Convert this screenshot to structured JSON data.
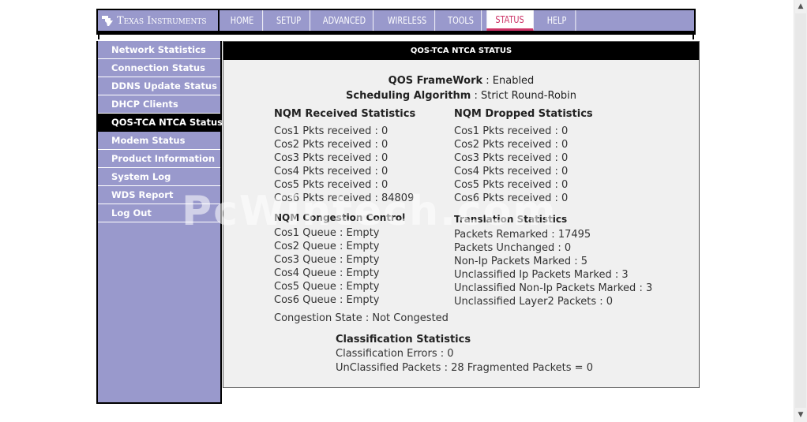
{
  "brand": {
    "name": "Texas Instruments",
    "icon": "ti-logo-icon"
  },
  "nav": {
    "tabs": [
      {
        "label": "HOME",
        "active": false
      },
      {
        "label": "SETUP",
        "active": false
      },
      {
        "label": "ADVANCED",
        "active": false
      },
      {
        "label": "WIRELESS",
        "active": false
      },
      {
        "label": "TOOLS",
        "active": false
      },
      {
        "label": "STATUS",
        "active": true
      },
      {
        "label": "HELP",
        "active": false
      }
    ]
  },
  "sidebar": {
    "items": [
      {
        "label": "Network Statistics",
        "active": false
      },
      {
        "label": "Connection Status",
        "active": false
      },
      {
        "label": "DDNS Update Status",
        "active": false
      },
      {
        "label": "DHCP Clients",
        "active": false
      },
      {
        "label": "QOS-TCA NTCA Status",
        "active": true
      },
      {
        "label": "Modem Status",
        "active": false
      },
      {
        "label": "Product Information",
        "active": false
      },
      {
        "label": "System Log",
        "active": false
      },
      {
        "label": "WDS Report",
        "active": false
      },
      {
        "label": "Log Out",
        "active": false
      }
    ]
  },
  "panel": {
    "title": "QOS-TCA NTCA STATUS",
    "framework": {
      "label": "QOS FrameWork",
      "value": " : Enabled"
    },
    "scheduling": {
      "label": "Scheduling Algorithm",
      "value": " : Strict Round-Robin"
    },
    "received": {
      "heading": "NQM Received Statistics",
      "rows": [
        "Cos1 Pkts received : 0",
        "Cos2 Pkts received : 0",
        "Cos3 Pkts received : 0",
        "Cos4 Pkts received : 0",
        "Cos5 Pkts received : 0",
        "Cos6 Pkts received : 84809"
      ]
    },
    "dropped": {
      "heading": "NQM Dropped Statistics",
      "rows": [
        "Cos1 Pkts received : 0",
        "Cos2 Pkts received : 0",
        "Cos3 Pkts received : 0",
        "Cos4 Pkts received : 0",
        "Cos5 Pkts received : 0",
        "Cos6 Pkts received : 0"
      ]
    },
    "congestion": {
      "heading": "NQM Congestion Control",
      "rows": [
        "Cos1 Queue : Empty",
        "Cos2 Queue : Empty",
        "Cos3 Queue : Empty",
        "Cos4 Queue : Empty",
        "Cos5 Queue : Empty",
        "Cos6 Queue : Empty"
      ],
      "state": "Congestion State : Not Congested"
    },
    "translation": {
      "heading": "Translation Statistics",
      "rows": [
        "Packets Remarked : 17495",
        "Packets Unchanged : 0",
        "Non-Ip Packets Marked : 5",
        "Unclassified Ip Packets Marked : 3",
        "Unclassified Non-Ip Packets Marked : 3",
        "Unclassified Layer2 Packets : 0"
      ]
    },
    "classification": {
      "heading": "Classification Statistics",
      "errors": "Classification Errors : 0",
      "unclassified": "UnClassified Packets : 28 Fragmented Packets = 0"
    }
  },
  "watermark": "PcWintech.com"
}
